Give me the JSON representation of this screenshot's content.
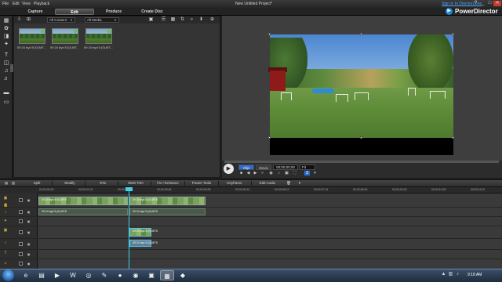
{
  "window": {
    "title": "New Untitled Project*",
    "menu": [
      "File",
      "Edit",
      "View",
      "Playback"
    ],
    "signin_label": "Sign in to DirectorZone",
    "brand": "PowerDirector",
    "controls": {
      "help": "?",
      "minimize": "_",
      "maximize": "□",
      "close": "✕"
    }
  },
  "modes": [
    {
      "label": "Capture"
    },
    {
      "label": "Edit",
      "active": true
    },
    {
      "label": "Produce"
    },
    {
      "label": "Create Disc"
    }
  ],
  "library": {
    "filter_content": "All Content",
    "filter_media": "All Media",
    "items": [
      {
        "label": "09 24 byd 5 (0).MT..."
      },
      {
        "label": "09 24 byd 5 (0).MT..."
      },
      {
        "label": "09 24 byd 5 (0).MT..."
      }
    ]
  },
  "player": {
    "clip_label": "Clip",
    "movie_label": "Movie",
    "timecode": "00;00;00;00",
    "fit_label": "Fit"
  },
  "timeline_tools": [
    "Split",
    "Modify",
    "Trim",
    "Multi Trim",
    "Fix / Enhance",
    "Power Tools",
    "Keyframe",
    "Edit Audio"
  ],
  "ruler_ticks": [
    "00;00;00;00",
    "00;00;01;02",
    "00;00;02;04",
    "00;00;03;06",
    "00;00;04;08",
    "00;00;05;10",
    "00;00;06;12",
    "00;00;07;14",
    "00;00;08;16",
    "00;00;09;18",
    "00;00;10;20",
    "00;00;11;22"
  ],
  "clips": {
    "video1_a": "09 24 byd 5 (0).MTS",
    "video1_b": "09 24 byd 5 (0).MTS",
    "audio1_a": "09 24 byd 5 (0).MTS",
    "audio1_b": "09 24 byd 5 (0).MTS",
    "video2": "09 24 byd 5 (0).MTS",
    "audio2": "09 24 byd 5 (0).MTS"
  },
  "taskbar": {
    "time": "9:18 AM"
  },
  "colors": {
    "accent": "#2b6fd6",
    "playhead": "#3fd3e8",
    "signin": "#4fa8ff"
  }
}
